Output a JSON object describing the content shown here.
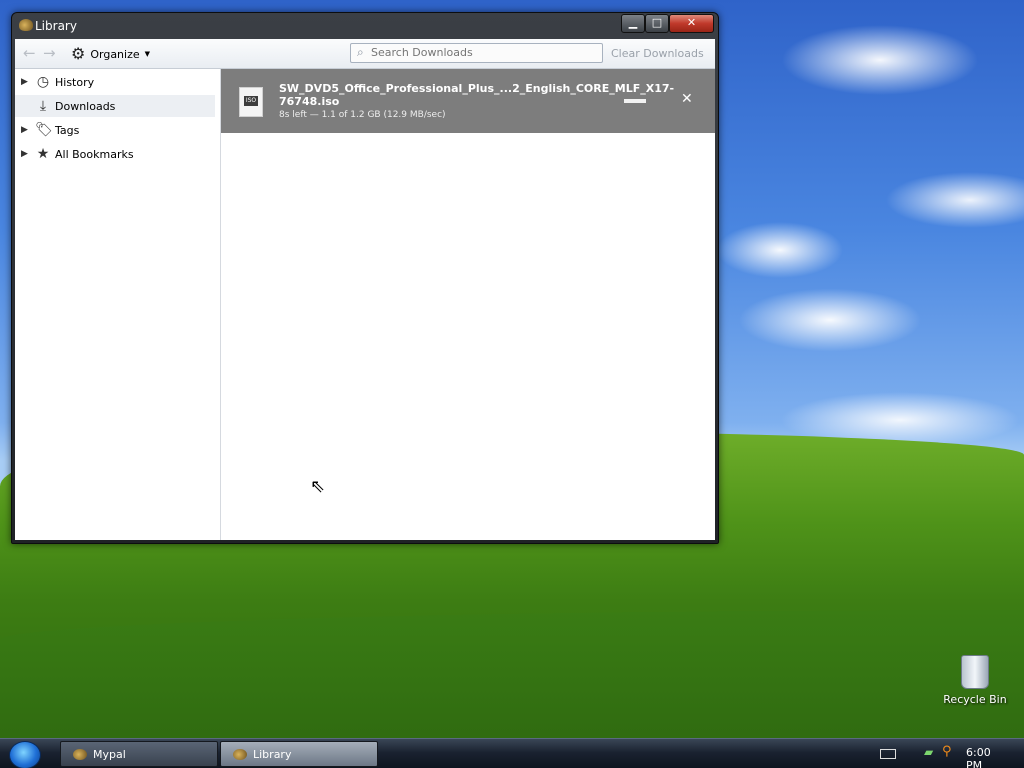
{
  "window": {
    "title": "Library"
  },
  "toolbar": {
    "organize_label": "Organize",
    "search_placeholder": "Search Downloads",
    "clear_label": "Clear Downloads"
  },
  "sidebar": {
    "items": [
      {
        "label": "History",
        "icon": "clock-icon"
      },
      {
        "label": "Downloads",
        "icon": "download-icon"
      },
      {
        "label": "Tags",
        "icon": "tag-icon"
      },
      {
        "label": "All Bookmarks",
        "icon": "star-icon"
      }
    ]
  },
  "downloads": [
    {
      "filename": "SW_DVD5_Office_Professional_Plus_...2_English_CORE_MLF_X17-76748.iso",
      "status": "8s left — 1.1 of 1.2 GB (12.9 MB/sec)",
      "progress": 0.92
    }
  ],
  "desktop": {
    "recycle_bin_label": "Recycle Bin"
  },
  "taskbar": {
    "items": [
      {
        "label": "Mypal"
      },
      {
        "label": "Library"
      }
    ],
    "clock": "6:00 PM"
  }
}
